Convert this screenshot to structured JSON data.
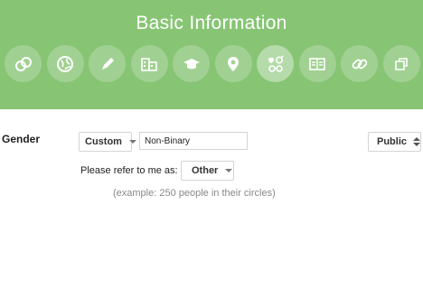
{
  "header": {
    "title": "Basic Information",
    "background_color": "#87c574",
    "icons": [
      {
        "name": "circles-icon"
      },
      {
        "name": "globe-icon"
      },
      {
        "name": "pencil-icon"
      },
      {
        "name": "building-icon"
      },
      {
        "name": "graduation-cap-icon"
      },
      {
        "name": "map-pin-icon"
      },
      {
        "name": "relationships-icon",
        "active": true
      },
      {
        "name": "contact-card-icon"
      },
      {
        "name": "link-icon"
      },
      {
        "name": "copy-icon"
      }
    ]
  },
  "gender": {
    "label": "Gender",
    "select_value": "Custom",
    "custom_value": "Non-Binary",
    "visibility": "Public",
    "pronoun_label": "Please refer to me as:",
    "pronoun_value": "Other",
    "hint": "(example: 250 people in their circles)"
  }
}
